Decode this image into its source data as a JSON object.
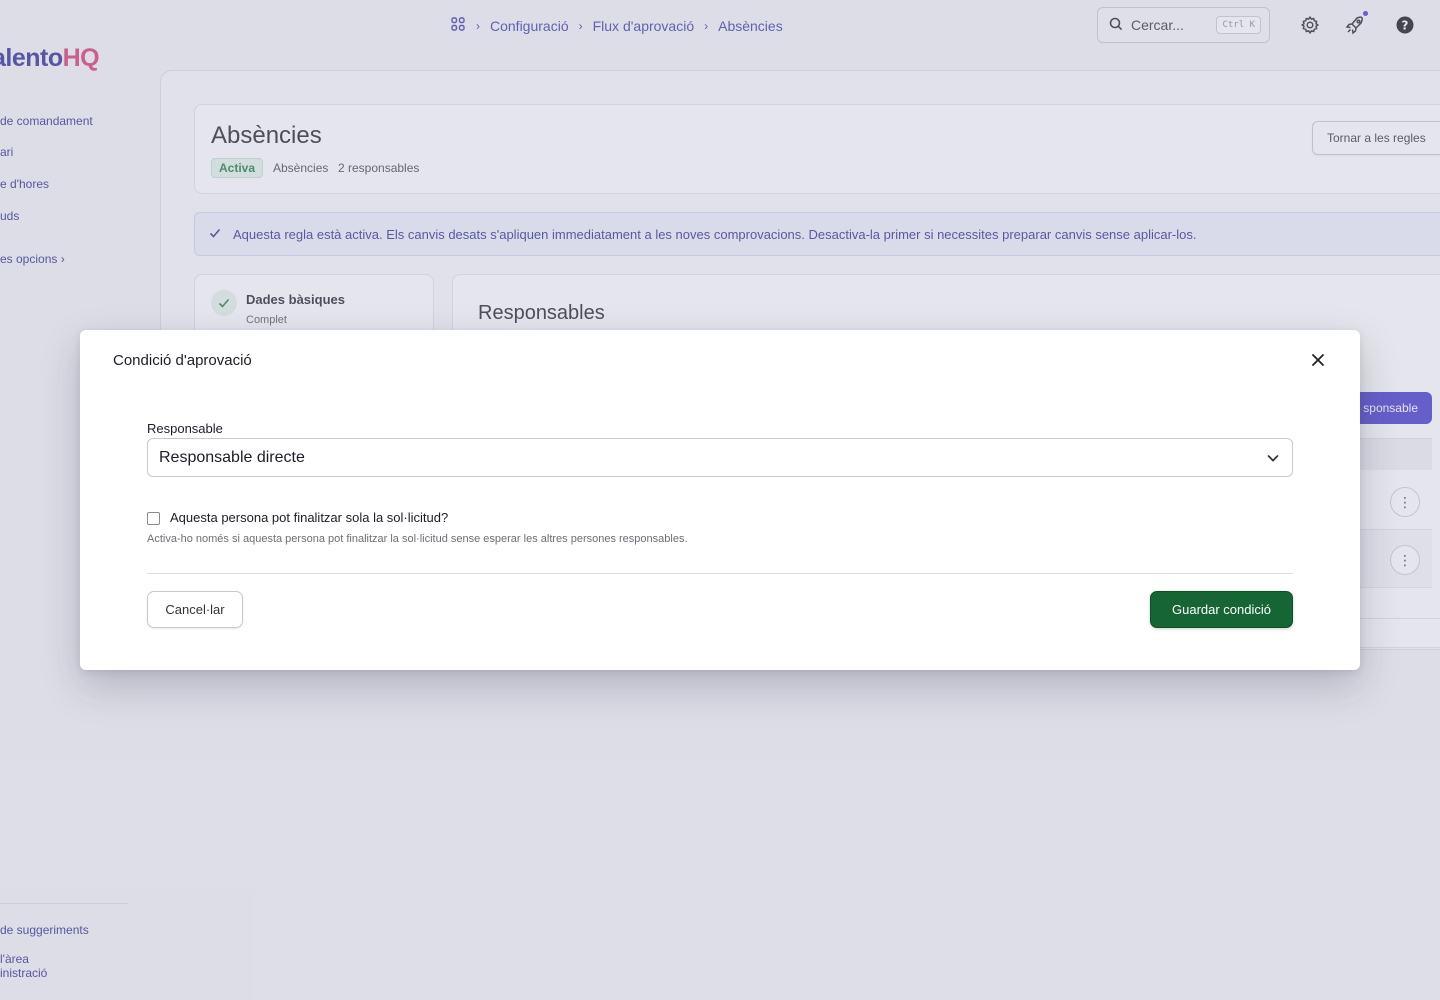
{
  "brand": {
    "part1": "alento",
    "part2": "HQ"
  },
  "sidebar": {
    "items": [
      {
        "label": " de comandament"
      },
      {
        "label": "ari"
      },
      {
        "label": "e d'hores"
      },
      {
        "label": "uds"
      },
      {
        "label": "es opcions"
      }
    ],
    "more_chevron": "›",
    "bottom_items": [
      {
        "label": "de suggeriments"
      },
      {
        "label": " l'àrea"
      },
      {
        "label": "inistració"
      }
    ]
  },
  "breadcrumb": {
    "items": [
      "Configuració",
      "Flux d'aprovació",
      "Absències"
    ],
    "separator": "›"
  },
  "search": {
    "placeholder": "Cercar...",
    "shortcut": "Ctrl K"
  },
  "header": {
    "title": "Absències",
    "status": "Activa",
    "type": "Absències",
    "responsables_count": "2 responsables",
    "back_label": "Tornar a les regles"
  },
  "banner": {
    "text": "Aquesta regla està activa. Els canvis desats s'apliquen immediatament a les noves comprovacions. Desactiva-la primer si necessites preparar canvis sense aplicar-los."
  },
  "steps": [
    {
      "title": "Dades bàsiques",
      "subtitle": "Complet"
    }
  ],
  "responsables": {
    "title": "Responsables",
    "add_label": "sponsable",
    "row_menu": "⋮"
  },
  "modal": {
    "title": "Condició d'aprovació",
    "field_label": "Responsable",
    "field_value": "Responsable directe",
    "checkbox_label": "Aquesta persona pot finalitzar sola la sol·licitud?",
    "checkbox_help": "Activa-ho només si aquesta persona pot finalitzar la sol·licitud sense esperar les altres persones responsables.",
    "checkbox_checked": false,
    "cancel_label": "Cancel·lar",
    "save_label": "Guardar condició"
  },
  "colors": {
    "primary": "#4338ca",
    "brand_accent": "#d9386f",
    "save": "#166534",
    "active_badge": "#1f7a3c"
  },
  "icons": [
    "apps-grid-icon",
    "search-icon",
    "gear-icon",
    "rocket-icon",
    "help-icon",
    "check-icon",
    "chevron-down-icon",
    "close-icon",
    "kebab-icon"
  ]
}
